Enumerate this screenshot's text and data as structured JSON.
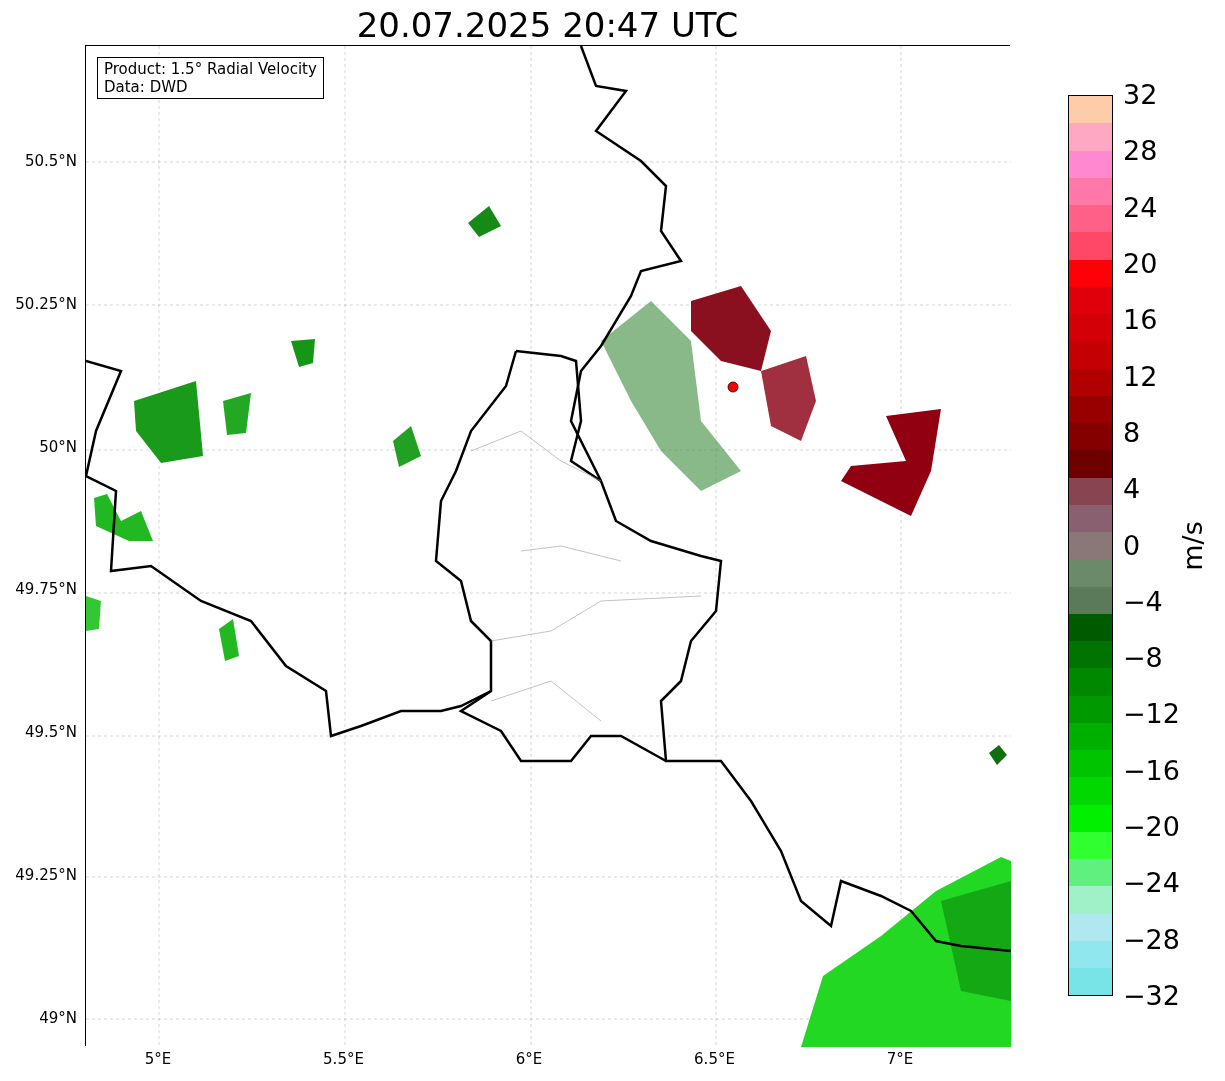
{
  "title": "20.07.2025 20:47 UTC",
  "legend": [
    "Product: 1.5° Radial Velocity",
    "Data: DWD"
  ],
  "map": {
    "lat_labels": [
      "50.5°N",
      "50.25°N",
      "50°N",
      "49.75°N",
      "49.5°N",
      "49.25°N",
      "49°N"
    ],
    "lon_labels": [
      "5°E",
      "5.5°E",
      "6°E",
      "6.5°E",
      "7°E"
    ]
  },
  "colorbar": {
    "unit": "m/s",
    "ticks": [
      "32",
      "28",
      "24",
      "20",
      "16",
      "12",
      "8",
      "4",
      "0",
      "−4",
      "−8",
      "−12",
      "−16",
      "−20",
      "−24",
      "−28",
      "−32"
    ],
    "segments": [
      {
        "color": "#ffccaa"
      },
      {
        "color": "#ffa8c4"
      },
      {
        "color": "#ff88d0"
      },
      {
        "color": "#ff78a8"
      },
      {
        "color": "#ff6088"
      },
      {
        "color": "#ff4868"
      },
      {
        "color": "#ff0008"
      },
      {
        "color": "#e0000c"
      },
      {
        "color": "#d40008"
      },
      {
        "color": "#c40004"
      },
      {
        "color": "#b00000"
      },
      {
        "color": "#980000"
      },
      {
        "color": "#840000"
      },
      {
        "color": "#6e0000"
      },
      {
        "color": "#884450"
      },
      {
        "color": "#886070"
      },
      {
        "color": "#8a7878"
      },
      {
        "color": "#6a8a6a"
      },
      {
        "color": "#5a7a5a"
      },
      {
        "color": "#005a00"
      },
      {
        "color": "#007400"
      },
      {
        "color": "#008800"
      },
      {
        "color": "#009a00"
      },
      {
        "color": "#00b000"
      },
      {
        "color": "#00c400"
      },
      {
        "color": "#00d800"
      },
      {
        "color": "#00f000"
      },
      {
        "color": "#30ff30"
      },
      {
        "color": "#60f080"
      },
      {
        "color": "#a0f0c8"
      },
      {
        "color": "#b0e8f0"
      },
      {
        "color": "#90e8ee"
      },
      {
        "color": "#78e4e8"
      }
    ]
  }
}
